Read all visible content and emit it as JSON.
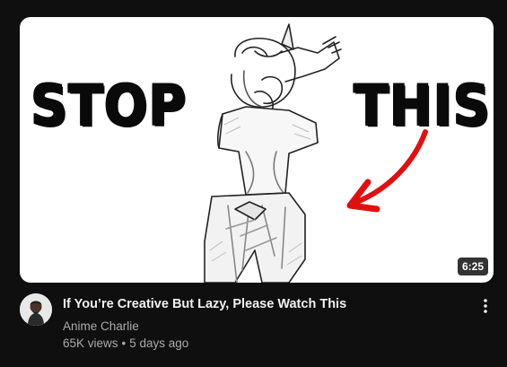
{
  "video": {
    "thumbnail_text_left": "STOP",
    "thumbnail_text_right": "THIS",
    "duration": "6:25",
    "title": "If You’re Creative But Lazy, Please Watch This",
    "channel": "Anime Charlie",
    "views": "65K views",
    "separator": "•",
    "age": "5 days ago"
  },
  "icons": {
    "menu": "more-vert-icon",
    "arrow": "red-arrow"
  },
  "colors": {
    "background": "#0f0f0f",
    "title": "#f1f1f1",
    "secondary_text": "#aaaaaa",
    "arrow": "#e01010"
  }
}
